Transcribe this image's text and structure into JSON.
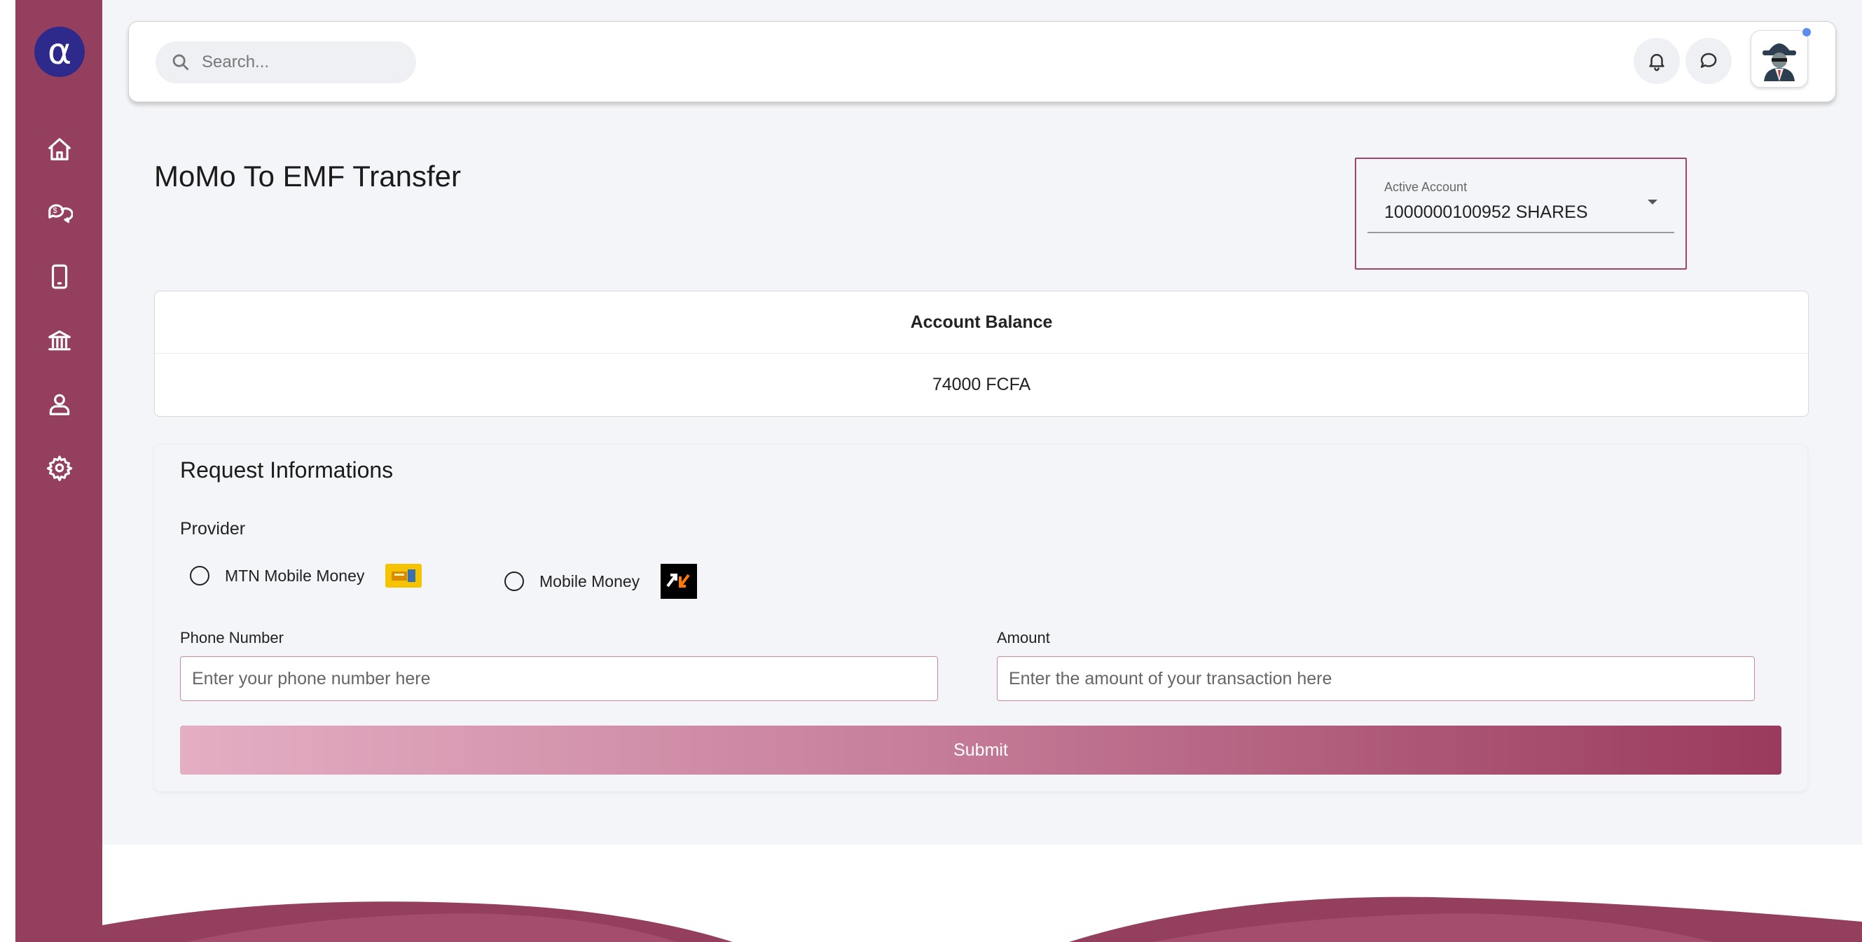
{
  "brand": {
    "logo_glyph": "α",
    "primary_color": "#943f5d",
    "logo_color": "#2d2a8c"
  },
  "sidebar": {
    "items": [
      {
        "icon": "home-icon"
      },
      {
        "icon": "chat-money-icon"
      },
      {
        "icon": "mobile-phone-icon"
      },
      {
        "icon": "bank-icon"
      },
      {
        "icon": "user-icon"
      },
      {
        "icon": "gear-icon"
      }
    ]
  },
  "header": {
    "search_placeholder": "Search...",
    "icons": [
      "bell-icon",
      "comment-icon"
    ],
    "avatar": "spy-avatar-icon"
  },
  "page": {
    "title": "MoMo To EMF Transfer"
  },
  "account_select": {
    "label": "Active Account",
    "value": "1000000100952 SHARES"
  },
  "balance": {
    "title": "Account Balance",
    "value": "74000 FCFA"
  },
  "request": {
    "title": "Request Informations",
    "provider_label": "Provider",
    "providers": [
      {
        "label": "MTN Mobile Money",
        "logo": "mtn-logo"
      },
      {
        "label": "Mobile Money",
        "logo": "orange-money-logo"
      }
    ],
    "phone_label": "Phone Number",
    "phone_placeholder": "Enter your phone number here",
    "amount_label": "Amount",
    "amount_placeholder": "Enter the amount of your transaction here",
    "submit_label": "Submit"
  }
}
